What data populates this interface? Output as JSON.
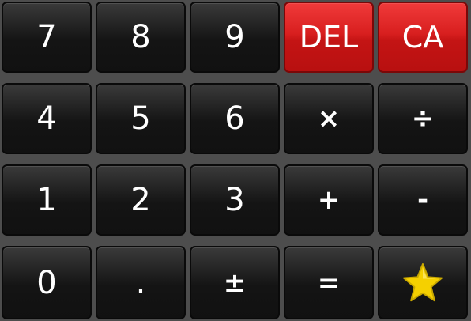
{
  "keys": {
    "seven": "7",
    "eight": "8",
    "nine": "9",
    "delete": "DEL",
    "clear_all": "CA",
    "four": "4",
    "five": "5",
    "six": "6",
    "multiply": "×",
    "divide": "÷",
    "one": "1",
    "two": "2",
    "three": "3",
    "add": "+",
    "subtract": "-",
    "zero": "0",
    "decimal": ".",
    "plus_minus": "±",
    "equals": "=",
    "favorite_icon": "star-icon"
  },
  "colors": {
    "key_bg": "#161616",
    "red_key_bg": "#d81f1f",
    "background": "#4d4d4d",
    "star": "#f5d000"
  }
}
